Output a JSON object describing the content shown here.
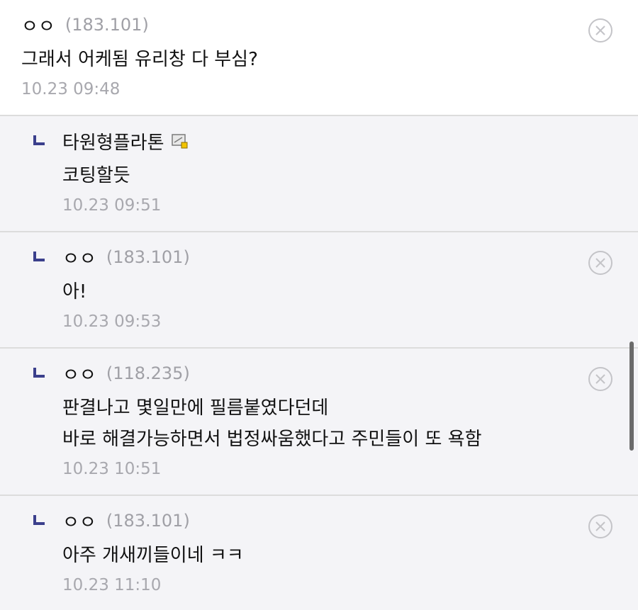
{
  "comments": [
    {
      "author": "ㅇㅇ",
      "ip": "(183.101)",
      "lines": [
        "그래서 어케됨 유리창 다 부심?"
      ],
      "time": "10.23 09:48",
      "is_reply": false,
      "deletable": true
    },
    {
      "author": "타원형플라톤",
      "ip": "",
      "lines": [
        "코팅할듯"
      ],
      "time": "10.23 09:51",
      "is_reply": true,
      "deletable": false,
      "badge_icon": "gallery-member-icon"
    },
    {
      "author": "ㅇㅇ",
      "ip": "(183.101)",
      "lines": [
        "아!"
      ],
      "time": "10.23 09:53",
      "is_reply": true,
      "deletable": true
    },
    {
      "author": "ㅇㅇ",
      "ip": "(118.235)",
      "lines": [
        "판결나고 몇일만에 필름붙였다던데",
        "바로 해결가능하면서 법정싸움했다고 주민들이 또 욕함"
      ],
      "time": "10.23 10:51",
      "is_reply": true,
      "deletable": true
    },
    {
      "author": "ㅇㅇ",
      "ip": "(183.101)",
      "lines": [
        "아주 개새끼들이네 ㅋㅋ"
      ],
      "time": "10.23 11:10",
      "is_reply": true,
      "deletable": true
    }
  ],
  "colors": {
    "reply_bg": "#f4f4f7",
    "reply_marker": "#3b3f8c",
    "meta_gray": "#a8a8ae",
    "divider": "#dcdcdc"
  },
  "icons": {
    "reply_marker": "reply-corner-icon",
    "delete": "close-circle-icon"
  }
}
